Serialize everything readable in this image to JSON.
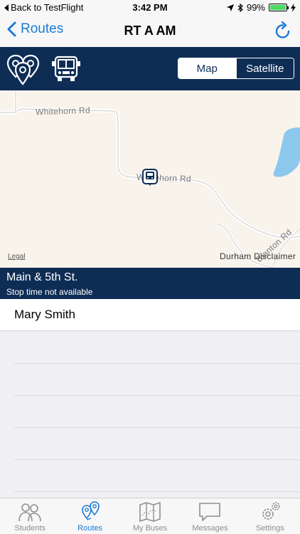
{
  "status_bar": {
    "back_label": "Back to TestFlight",
    "time": "3:42 PM",
    "battery": "99%",
    "battery_level": 0.99
  },
  "nav": {
    "back_label": "Routes",
    "title": "RT A AM"
  },
  "map_toggle": {
    "map_label": "Map",
    "satellite_label": "Satellite",
    "selected": "Map"
  },
  "map": {
    "road_labels": [
      "Whitehorn Rd",
      "Whitehorn Rd",
      "Durham Disclaimer",
      "Blanton Rd"
    ],
    "legal_label": "Legal"
  },
  "stop": {
    "name": "Main & 5th St.",
    "time_text": "Stop time not available"
  },
  "students": [
    "Mary Smith"
  ],
  "tabs": [
    {
      "label": "Students",
      "icon": "students-icon",
      "active": false
    },
    {
      "label": "Routes",
      "icon": "routes-icon",
      "active": true
    },
    {
      "label": "My Buses",
      "icon": "map-icon",
      "active": false
    },
    {
      "label": "Messages",
      "icon": "message-icon",
      "active": false
    },
    {
      "label": "Settings",
      "icon": "gear-icon",
      "active": false
    }
  ],
  "colors": {
    "brand_navy": "#0e2d55",
    "accent_blue": "#1a7ad4",
    "map_bg": "#f8f4ec",
    "water": "#8cc8ec",
    "battery_green": "#4cd964"
  }
}
